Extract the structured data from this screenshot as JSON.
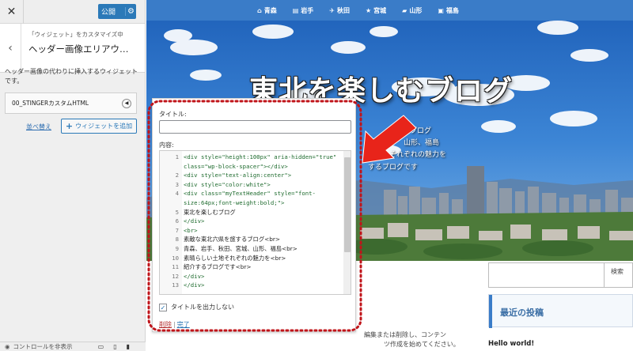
{
  "sidebar": {
    "close_glyph": "✕",
    "publish_label": "公開",
    "back_glyph": "‹",
    "breadcrumb": "「ウィジェット」をカスタマイズ中",
    "section_title": "ヘッダー画像エリアウ…",
    "description": "ヘッダー画像の代わりに挿入するウィジェットです。",
    "widget_name": "00_STINGERカスタムHTML",
    "reorder_label": "並べ替え",
    "add_widget_label": "ウィジェットを追加",
    "controls_label": "コントロールを非表示"
  },
  "topnav": {
    "items": [
      {
        "label": "青森",
        "icon": "home-icon",
        "glyph": "⌂"
      },
      {
        "label": "岩手",
        "icon": "train-icon",
        "glyph": "▤"
      },
      {
        "label": "秋田",
        "icon": "plane-icon",
        "glyph": "✈"
      },
      {
        "label": "宮城",
        "icon": "star-icon",
        "glyph": "★"
      },
      {
        "label": "山形",
        "icon": "car-icon",
        "glyph": "▰"
      },
      {
        "label": "福島",
        "icon": "bus-icon",
        "glyph": "▣"
      }
    ]
  },
  "hero": {
    "blog_title": "東北を楽しむブログ",
    "line1": "ブログ",
    "line2": "山形、福島",
    "line3": "それぞれの魅力を",
    "line4": "するブログです"
  },
  "editor": {
    "title_label": "タイトル:",
    "title_value": "",
    "content_label": "内容:",
    "code_lines": [
      {
        "n": "1",
        "text": "<div style=\"height:100px\" aria-hidden=\"true\""
      },
      {
        "n": "",
        "text": "class=\"wp-block-spacer\"></div>"
      },
      {
        "n": "2",
        "text": "<div style=\"text-align:center\">"
      },
      {
        "n": "3",
        "text": "<div style=\"color:white\">"
      },
      {
        "n": "4",
        "text": "<div class=\"myTextHeader\" style=\"font-"
      },
      {
        "n": "",
        "text": "size:64px;font-weight:bold;\">"
      },
      {
        "n": "5",
        "text": "東北を楽しむブログ"
      },
      {
        "n": "6",
        "text": "</div>"
      },
      {
        "n": "7",
        "text": "<br>"
      },
      {
        "n": "8",
        "text": "素敵な東北六県を旅するブログ<br>"
      },
      {
        "n": "9",
        "text": "青森、岩手、秋田、宮城、山形、福島<br>"
      },
      {
        "n": "10",
        "text": "素晴らしい土地それぞれの魅力を<br>"
      },
      {
        "n": "11",
        "text": "紹介するブログです<br>"
      },
      {
        "n": "12",
        "text": "</div>"
      },
      {
        "n": "13",
        "text": "</div>"
      }
    ],
    "hide_title_label": "タイトルを出力しない",
    "hide_title_checked": true,
    "delete_label": "削除",
    "separator": "|",
    "done_label": "完了"
  },
  "page": {
    "search_button": "検索",
    "recent_posts_title": "最近の投稿",
    "post_title": "Hello world!",
    "snippet1": "編集または削除し、コンテン",
    "snippet2": "ツ作成を始めてください。"
  },
  "colors": {
    "nav_blue": "#3a7cc8",
    "publish_blue": "#2b79b8",
    "highlight_red": "#c0141a",
    "arrow_red": "#e8241a"
  }
}
